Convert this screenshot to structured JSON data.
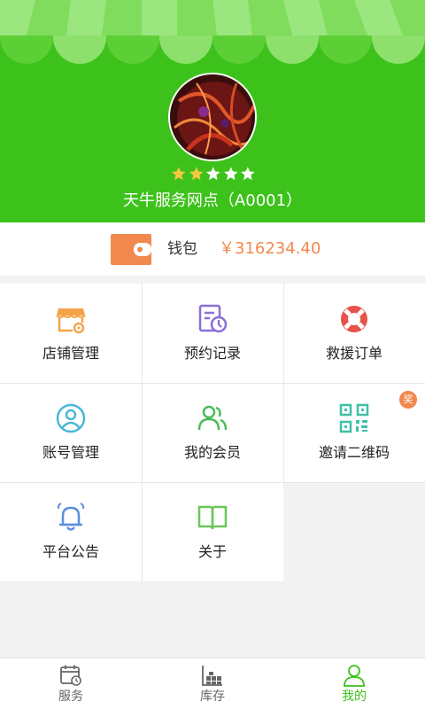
{
  "profile": {
    "name": "天牛服务网点（A0001）",
    "rating": 2,
    "rating_max": 5
  },
  "wallet": {
    "label": "钱包",
    "amount": "￥316234.40"
  },
  "menu": [
    {
      "label": "店铺管理",
      "icon": "store-icon"
    },
    {
      "label": "预约记录",
      "icon": "appointment-record-icon"
    },
    {
      "label": "救援订单",
      "icon": "lifebuoy-icon"
    },
    {
      "label": "账号管理",
      "icon": "account-icon"
    },
    {
      "label": "我的会员",
      "icon": "members-icon"
    },
    {
      "label": "邀请二维码",
      "icon": "qrcode-icon"
    },
    {
      "label": "平台公告",
      "icon": "bell-icon"
    },
    {
      "label": "关于",
      "icon": "book-icon"
    }
  ],
  "invite_badge": "奖",
  "tabbar": {
    "tabs": [
      {
        "label": "服务",
        "icon": "service-calendar-icon"
      },
      {
        "label": "库存",
        "icon": "inventory-icon"
      },
      {
        "label": "我的",
        "icon": "profile-icon"
      }
    ],
    "active": "我的"
  },
  "colors": {
    "header_green": "#3dc21b",
    "accent_orange": "#f1894f",
    "star_gold": "#f5c842"
  }
}
